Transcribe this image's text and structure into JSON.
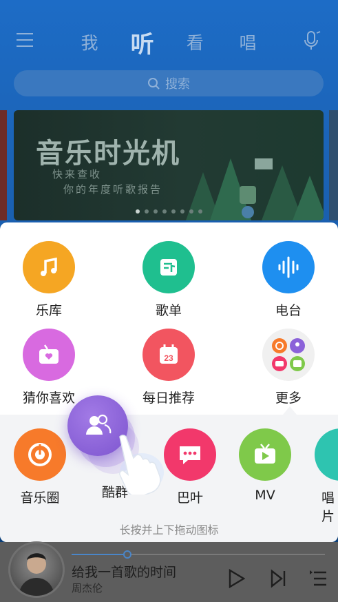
{
  "header": {
    "tabs": [
      {
        "label": "我",
        "active": false
      },
      {
        "label": "听",
        "active": true
      },
      {
        "label": "看",
        "active": false
      },
      {
        "label": "唱",
        "active": false
      }
    ],
    "search_placeholder": "搜索"
  },
  "banner": {
    "title": "音乐时光机",
    "line1": "快来查收",
    "line2": "你的年度听歌报告",
    "page_count": 8,
    "current_page": 1
  },
  "panel": {
    "grid": [
      {
        "label": "乐库",
        "icon": "music-note-icon",
        "color": "#f5a623"
      },
      {
        "label": "歌单",
        "icon": "playlist-icon",
        "color": "#1fbf8f"
      },
      {
        "label": "电台",
        "icon": "radio-wave-icon",
        "color": "#1e8ff0"
      },
      {
        "label": "猜你喜欢",
        "icon": "tv-heart-icon",
        "color": "#d86ae0"
      },
      {
        "label": "每日推荐",
        "icon": "calendar-icon",
        "color": "#f25560"
      },
      {
        "label": "更多",
        "icon": "more-grid-icon",
        "color": "#f0f0f0"
      }
    ],
    "calendar_day": "23",
    "tray": [
      {
        "label": "音乐圈",
        "icon": "music-circle-icon",
        "color": "#f77a2a"
      },
      {
        "label": "酷群",
        "icon": "group-icon",
        "color": "#8b62d9"
      },
      {
        "label": "巴叶",
        "icon": "chat-bubble-icon",
        "color": "#f2386b"
      },
      {
        "label": "MV",
        "icon": "tv-play-icon",
        "color": "#7fc94a"
      },
      {
        "label": "唱片",
        "icon": "record-icon",
        "color": "#2ec4b0"
      }
    ],
    "hint": "长按并上下拖动图标"
  },
  "player": {
    "song": "给我一首歌的时间",
    "artist": "周杰伦",
    "progress": 0.22
  }
}
